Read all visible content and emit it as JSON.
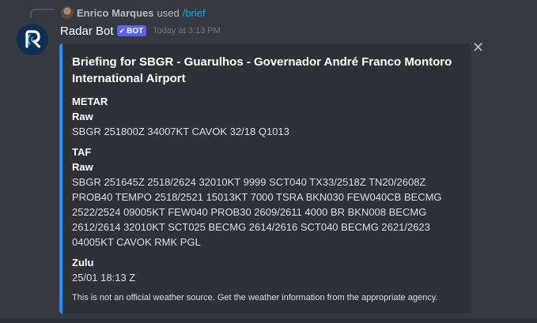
{
  "reply": {
    "username": "Enrico Marques",
    "used_text": "used",
    "command": "/brief"
  },
  "message": {
    "author": "Radar Bot",
    "badge": "BOT",
    "timestamp": "Today at 3:13 PM"
  },
  "embed": {
    "accent_color": "#1e90ff",
    "title": "Briefing for SBGR - Guarulhos - Governador André Franco Montoro International Airport",
    "metar_heading": "METAR",
    "metar_raw_label": "Raw",
    "metar_raw": "SBGR 251800Z 34007KT CAVOK 32/18 Q1013",
    "taf_heading": "TAF",
    "taf_raw_label": "Raw",
    "taf_raw_lines": [
      "SBGR 251645Z 2518/2624 32010KT 9999 SCT040 TX33/2518Z TN20/2608Z",
      "PROB40 TEMPO 2518/2521 15013KT 7000 TSRA BKN030 FEW040CB BECMG",
      "2522/2524 09005KT FEW040 PROB30 2609/2611 4000 BR BKN008 BECMG",
      "2612/2614 32010KT SCT025 BECMG 2614/2616 SCT040 BECMG 2621/2623",
      "04005KT CAVOK RMK PGL"
    ],
    "zulu_label": "Zulu",
    "zulu_value": "25/01 18:13 Z",
    "footer": "This is not an official weather source. Get the weather information from the appropriate agency."
  },
  "icons": {
    "close": "close-icon",
    "badge_check": "checkmark-icon"
  },
  "colors": {
    "background": "#36393f",
    "embed_background": "#2f3136",
    "badge": "#5865f2",
    "command_link": "#00aff4"
  }
}
